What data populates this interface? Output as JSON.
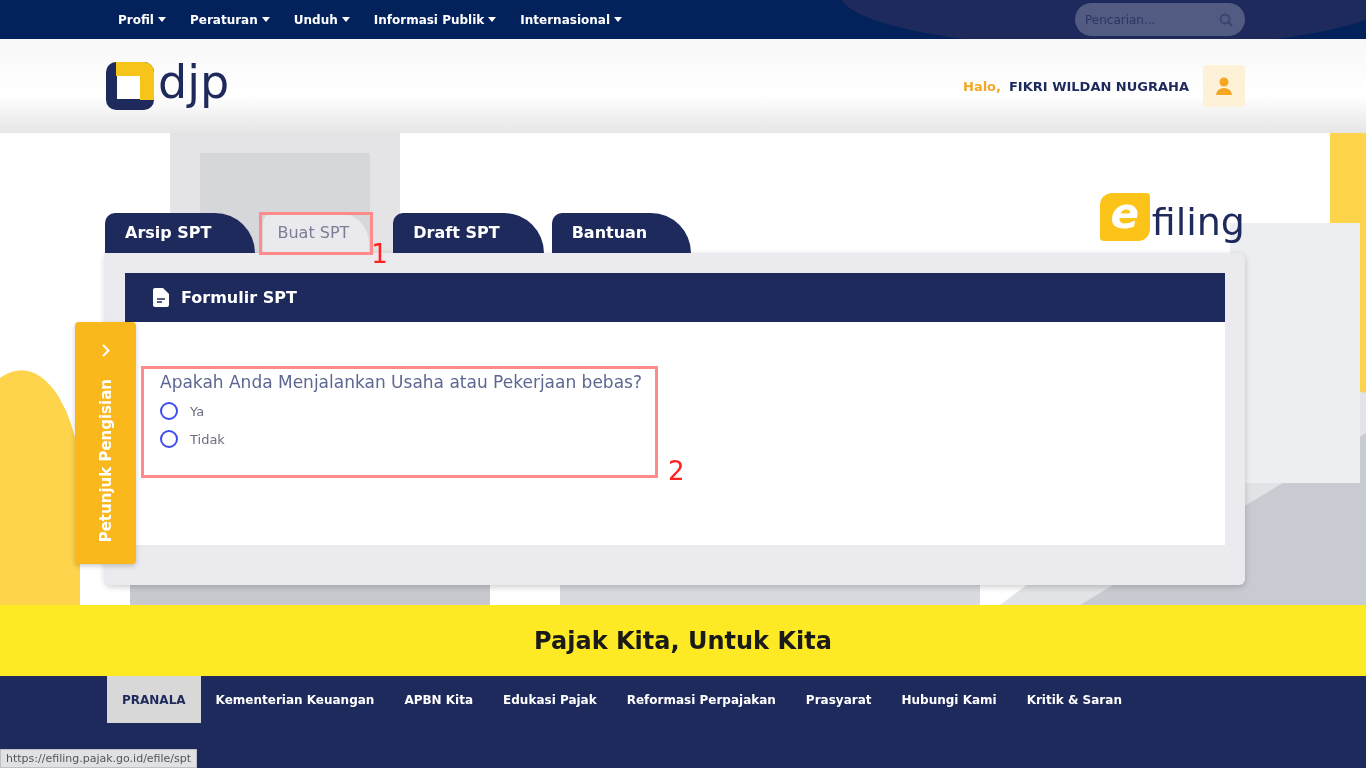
{
  "top_nav": {
    "items": [
      "Profil",
      "Peraturan",
      "Unduh",
      "Informasi Publik",
      "Internasional"
    ],
    "search": {
      "placeholder": "Pencarian..."
    }
  },
  "header": {
    "logo_text": "djp",
    "greeting": "Halo,",
    "user_name": "FIKRI WILDAN NUGRAHA"
  },
  "efiling_logo": {
    "mark": "e",
    "text": "filing"
  },
  "tabs": [
    {
      "label": "Arsip SPT",
      "selected": false
    },
    {
      "label": "Buat SPT",
      "selected": true
    },
    {
      "label": "Draft SPT",
      "selected": false
    },
    {
      "label": "Bantuan",
      "selected": false
    }
  ],
  "panel": {
    "title": "Formulir SPT",
    "question": "Apakah Anda Menjalankan Usaha atau Pekerjaan bebas?",
    "options": [
      {
        "label": "Ya",
        "selected": false
      },
      {
        "label": "Tidak",
        "selected": false
      }
    ]
  },
  "side_tab": {
    "label": "Petunjuk Pengisian"
  },
  "annotations": [
    {
      "number": "1"
    },
    {
      "number": "2"
    }
  ],
  "banner": {
    "text": "Pajak Kita, Untuk Kita"
  },
  "footer": {
    "links": [
      {
        "label": "PRANALA",
        "selected": true
      },
      {
        "label": "Kementerian Keuangan",
        "selected": false
      },
      {
        "label": "APBN Kita",
        "selected": false
      },
      {
        "label": "Edukasi Pajak",
        "selected": false
      },
      {
        "label": "Reformasi Perpajakan",
        "selected": false
      },
      {
        "label": "Prasyarat",
        "selected": false
      },
      {
        "label": "Hubungi Kami",
        "selected": false
      },
      {
        "label": "Kritik & Saran",
        "selected": false
      }
    ]
  },
  "status_bar": {
    "url": "https://efiling.pajak.go.id/efile/spt"
  }
}
